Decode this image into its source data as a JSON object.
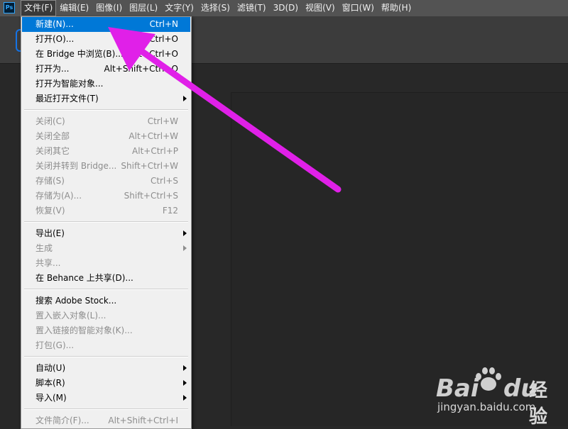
{
  "app": {
    "logo": "Ps"
  },
  "menubar": [
    {
      "label": "文件(F)",
      "active": true
    },
    {
      "label": "编辑(E)"
    },
    {
      "label": "图像(I)"
    },
    {
      "label": "图层(L)"
    },
    {
      "label": "文字(Y)"
    },
    {
      "label": "选择(S)"
    },
    {
      "label": "滤镜(T)"
    },
    {
      "label": "3D(D)"
    },
    {
      "label": "视图(V)"
    },
    {
      "label": "窗口(W)"
    },
    {
      "label": "帮助(H)"
    }
  ],
  "file_menu": {
    "items": [
      {
        "label": "新建(N)...",
        "shortcut": "Ctrl+N",
        "highlighted": true
      },
      {
        "label": "打开(O)...",
        "shortcut": "Ctrl+O"
      },
      {
        "label": "在 Bridge 中浏览(B)...",
        "shortcut": "Alt+Ctrl+O"
      },
      {
        "label": "打开为...",
        "shortcut": "Alt+Shift+Ctrl+O"
      },
      {
        "label": "打开为智能对象..."
      },
      {
        "label": "最近打开文件(T)",
        "submenu": true
      },
      {
        "label": "关闭(C)",
        "shortcut": "Ctrl+W",
        "disabled": true
      },
      {
        "label": "关闭全部",
        "shortcut": "Alt+Ctrl+W",
        "disabled": true
      },
      {
        "label": "关闭其它",
        "shortcut": "Alt+Ctrl+P",
        "disabled": true
      },
      {
        "label": "关闭并转到 Bridge...",
        "shortcut": "Shift+Ctrl+W",
        "disabled": true
      },
      {
        "label": "存储(S)",
        "shortcut": "Ctrl+S",
        "disabled": true
      },
      {
        "label": "存储为(A)...",
        "shortcut": "Shift+Ctrl+S",
        "disabled": true
      },
      {
        "label": "恢复(V)",
        "shortcut": "F12",
        "disabled": true
      },
      {
        "label": "导出(E)",
        "submenu": true
      },
      {
        "label": "生成",
        "submenu": true,
        "disabled": true
      },
      {
        "label": "共享...",
        "disabled": true
      },
      {
        "label": "在 Behance 上共享(D)..."
      },
      {
        "label": "搜索 Adobe Stock..."
      },
      {
        "label": "置入嵌入对象(L)...",
        "disabled": true
      },
      {
        "label": "置入链接的智能对象(K)...",
        "disabled": true
      },
      {
        "label": "打包(G)...",
        "disabled": true
      },
      {
        "label": "自动(U)",
        "submenu": true
      },
      {
        "label": "脚本(R)",
        "submenu": true
      },
      {
        "label": "导入(M)",
        "submenu": true
      },
      {
        "label": "文件简介(F)...",
        "shortcut": "Alt+Shift+Ctrl+I",
        "disabled": true
      }
    ]
  },
  "annotation": {
    "type": "arrow",
    "color": "#e020e8"
  },
  "watermark": {
    "brand_bai": "Bai",
    "brand_du": "du",
    "brand_cn": "经验",
    "url": "jingyan.baidu.com"
  },
  "colors": {
    "highlight": "#0078d7",
    "accent": "#1473e6"
  }
}
